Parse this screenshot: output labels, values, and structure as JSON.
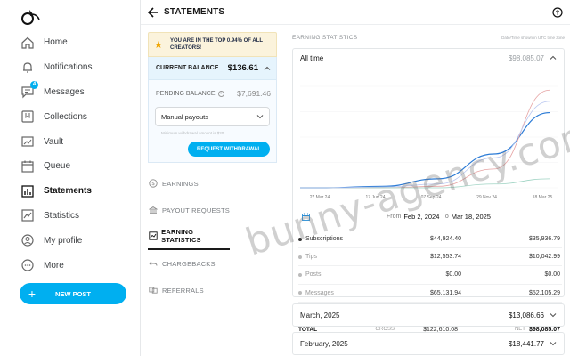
{
  "sidebar": {
    "items": [
      {
        "label": "Home",
        "icon": "home-icon"
      },
      {
        "label": "Notifications",
        "icon": "bell-icon"
      },
      {
        "label": "Messages",
        "icon": "chat-icon",
        "badge": "4"
      },
      {
        "label": "Collections",
        "icon": "bookmark-icon"
      },
      {
        "label": "Vault",
        "icon": "image-icon"
      },
      {
        "label": "Queue",
        "icon": "calendar-icon"
      },
      {
        "label": "Statements",
        "icon": "bars-icon",
        "active": true
      },
      {
        "label": "Statistics",
        "icon": "trend-icon"
      },
      {
        "label": "My profile",
        "icon": "user-icon"
      },
      {
        "label": "More",
        "icon": "more-icon"
      }
    ],
    "new_post_label": "NEW POST"
  },
  "header": {
    "title": "STATEMENTS"
  },
  "banner": {
    "text": "YOU ARE IN THE TOP 0.94% OF ALL CREATORS!"
  },
  "balance": {
    "current_label": "CURRENT BALANCE",
    "current_value": "$136.61",
    "pending_label": "PENDING BALANCE",
    "pending_value": "$7,691.46",
    "payout_select": "Manual payouts",
    "min_note": "Minimum withdrawal amount is $20",
    "request_label": "REQUEST WITHDRAWAL"
  },
  "menu": [
    {
      "label": "EARNINGS",
      "icon": "dollar-icon"
    },
    {
      "label": "PAYOUT REQUESTS",
      "icon": "bank-icon"
    },
    {
      "label": "EARNING STATISTICS",
      "icon": "chart-icon",
      "active": true
    },
    {
      "label": "CHARGEBACKS",
      "icon": "undo-icon"
    },
    {
      "label": "REFERRALS",
      "icon": "referral-icon"
    }
  ],
  "stats": {
    "title": "EARNING STATISTICS",
    "note": "Date/Time shown in UTC time zone",
    "period_label": "All time",
    "period_value": "$98,085.07",
    "from_label": "From",
    "from_date": "Feb 2, 2024",
    "to_label": "To",
    "to_date": "Mar 18, 2025",
    "rows": [
      {
        "name": "Subscriptions",
        "gross": "$44,924.40",
        "net": "$35,936.79",
        "muted": false
      },
      {
        "name": "Tips",
        "gross": "$12,553.74",
        "net": "$10,042.99",
        "muted": true
      },
      {
        "name": "Posts",
        "gross": "$0.00",
        "net": "$0.00",
        "muted": true
      },
      {
        "name": "Messages",
        "gross": "$65,131.94",
        "net": "$52,105.29",
        "muted": true
      },
      {
        "name": "Referrals",
        "gross": "$0.00",
        "net": "$0.00",
        "muted": true
      }
    ],
    "total": {
      "label": "TOTAL",
      "gross_label": "GROSS",
      "gross": "$122,610.08",
      "net_label": "NET",
      "net": "$98,085.07"
    }
  },
  "months": [
    {
      "name": "March, 2025",
      "value": "$13,086.66"
    },
    {
      "name": "February, 2025",
      "value": "$18,441.77"
    }
  ],
  "watermark": "bunny-agency.com",
  "chart_data": {
    "type": "line",
    "x": [
      "27 Mar 24",
      "17 Jun 24",
      "07 Sep 24",
      "29 Nov 24",
      "18 Mar 25"
    ],
    "series": [
      {
        "color": "#2b7bd6",
        "values": [
          0.0,
          0.02,
          0.12,
          0.45,
          1.0
        ]
      },
      {
        "color": "#e6a4a4",
        "values": [
          0.0,
          0.0,
          0.02,
          0.25,
          1.3
        ]
      },
      {
        "color": "#9fd3c3",
        "values": [
          0.0,
          0.0,
          0.0,
          0.05,
          0.12
        ]
      },
      {
        "color": "#b9c7f0",
        "values": [
          0.0,
          0.01,
          0.05,
          0.4,
          1.15
        ]
      }
    ],
    "grid": true
  }
}
